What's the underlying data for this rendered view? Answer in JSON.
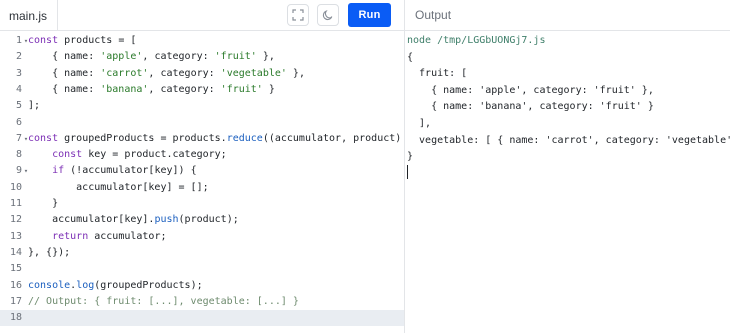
{
  "editor": {
    "filename": "main.js",
    "run_label": "Run",
    "fullscreen_icon": "fullscreen-icon",
    "theme_icon": "moon-icon",
    "accent_color": "#0a5cf5",
    "lines": [
      {
        "num": "1",
        "fold": "▾",
        "tokens": [
          {
            "t": "const",
            "c": "kw"
          },
          {
            "t": " products = ["
          }
        ]
      },
      {
        "num": "2",
        "fold": "",
        "tokens": [
          {
            "t": "    { name: "
          },
          {
            "t": "'apple'",
            "c": "str"
          },
          {
            "t": ", category: "
          },
          {
            "t": "'fruit'",
            "c": "str"
          },
          {
            "t": " },"
          }
        ]
      },
      {
        "num": "3",
        "fold": "",
        "tokens": [
          {
            "t": "    { name: "
          },
          {
            "t": "'carrot'",
            "c": "str"
          },
          {
            "t": ", category: "
          },
          {
            "t": "'vegetable'",
            "c": "str"
          },
          {
            "t": " },"
          }
        ]
      },
      {
        "num": "4",
        "fold": "",
        "tokens": [
          {
            "t": "    { name: "
          },
          {
            "t": "'banana'",
            "c": "str"
          },
          {
            "t": ", category: "
          },
          {
            "t": "'fruit'",
            "c": "str"
          },
          {
            "t": " }"
          }
        ]
      },
      {
        "num": "5",
        "fold": "",
        "tokens": [
          {
            "t": "];"
          }
        ]
      },
      {
        "num": "6",
        "fold": "",
        "tokens": []
      },
      {
        "num": "7",
        "fold": "▾",
        "tokens": [
          {
            "t": "const",
            "c": "kw"
          },
          {
            "t": " groupedProducts = products."
          },
          {
            "t": "reduce",
            "c": "fn"
          },
          {
            "t": "((accumulator, product) "
          },
          {
            "t": "=>",
            "c": "kw"
          },
          {
            "t": " {"
          }
        ]
      },
      {
        "num": "8",
        "fold": "",
        "tokens": [
          {
            "t": "    "
          },
          {
            "t": "const",
            "c": "kw"
          },
          {
            "t": " key = product.category;"
          }
        ]
      },
      {
        "num": "9",
        "fold": "▾",
        "tokens": [
          {
            "t": "    "
          },
          {
            "t": "if",
            "c": "kw"
          },
          {
            "t": " (!accumulator[key]) {"
          }
        ]
      },
      {
        "num": "10",
        "fold": "",
        "tokens": [
          {
            "t": "        accumulator[key] = [];"
          }
        ]
      },
      {
        "num": "11",
        "fold": "",
        "tokens": [
          {
            "t": "    }"
          }
        ]
      },
      {
        "num": "12",
        "fold": "",
        "tokens": [
          {
            "t": "    accumulator[key]."
          },
          {
            "t": "push",
            "c": "fn"
          },
          {
            "t": "(product);"
          }
        ]
      },
      {
        "num": "13",
        "fold": "",
        "tokens": [
          {
            "t": "    "
          },
          {
            "t": "return",
            "c": "kw"
          },
          {
            "t": " accumulator;"
          }
        ]
      },
      {
        "num": "14",
        "fold": "",
        "tokens": [
          {
            "t": "}, {});"
          }
        ]
      },
      {
        "num": "15",
        "fold": "",
        "tokens": []
      },
      {
        "num": "16",
        "fold": "",
        "tokens": [
          {
            "t": "console",
            "c": "fn"
          },
          {
            "t": "."
          },
          {
            "t": "log",
            "c": "fn"
          },
          {
            "t": "(groupedProducts);"
          }
        ]
      },
      {
        "num": "17",
        "fold": "",
        "tokens": [
          {
            "t": "// Output: { fruit: [...], vegetable: [...] }",
            "c": "cmt"
          }
        ]
      },
      {
        "num": "18",
        "fold": "",
        "tokens": [],
        "active": true
      }
    ]
  },
  "output": {
    "title": "Output",
    "lines": [
      {
        "text": "node /tmp/LGGbUONGj7.js",
        "cmd": true
      },
      {
        "text": "{"
      },
      {
        "text": "  fruit: ["
      },
      {
        "text": "    { name: 'apple', category: 'fruit' },"
      },
      {
        "text": "    { name: 'banana', category: 'fruit' }"
      },
      {
        "text": "  ],"
      },
      {
        "text": "  vegetable: [ { name: 'carrot', category: 'vegetable' } ]"
      },
      {
        "text": "}"
      }
    ]
  }
}
